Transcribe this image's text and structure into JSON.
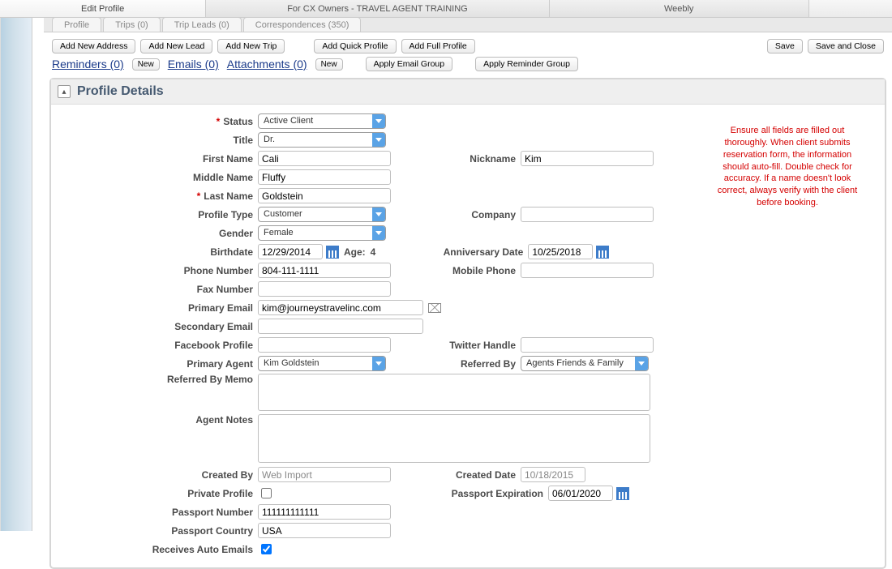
{
  "topTabs": [
    "Edit Profile",
    "For CX Owners - TRAVEL AGENT TRAINING",
    "Weebly"
  ],
  "subTabs": [
    "Profile",
    "Trips (0)",
    "Trip Leads (0)",
    "Correspondences (350)"
  ],
  "toolbar": {
    "addAddress": "Add New Address",
    "addLead": "Add New Lead",
    "addTrip": "Add New Trip",
    "addQuick": "Add Quick Profile",
    "addFull": "Add Full Profile",
    "save": "Save",
    "saveClose": "Save and Close"
  },
  "linkbar": {
    "reminders": "Reminders (0)",
    "new1": "New",
    "emails": "Emails (0)",
    "attachments": "Attachments (0)",
    "new2": "New",
    "applyEmail": "Apply Email Group",
    "applyReminder": "Apply Reminder Group"
  },
  "panelTitle": "Profile Details",
  "labels": {
    "status": "Status",
    "title": "Title",
    "firstName": "First Name",
    "middleName": "Middle Name",
    "lastName": "Last Name",
    "profileType": "Profile Type",
    "gender": "Gender",
    "birthdate": "Birthdate",
    "age": "Age:",
    "phone": "Phone Number",
    "fax": "Fax Number",
    "primaryEmail": "Primary Email",
    "secondaryEmail": "Secondary Email",
    "facebook": "Facebook Profile",
    "primaryAgent": "Primary Agent",
    "referredMemo": "Referred By Memo",
    "agentNotes": "Agent Notes",
    "createdBy": "Created By",
    "privateProfile": "Private Profile",
    "passportNumber": "Passport Number",
    "passportCountry": "Passport Country",
    "autoEmails": "Receives Auto Emails",
    "nickname": "Nickname",
    "company": "Company",
    "anniversary": "Anniversary Date",
    "mobile": "Mobile Phone",
    "twitter": "Twitter Handle",
    "referredBy": "Referred By",
    "createdDate": "Created Date",
    "passportExp": "Passport Expiration"
  },
  "values": {
    "status": "Active Client",
    "title": "Dr.",
    "firstName": "Cali",
    "middleName": "Fluffy",
    "lastName": "Goldstein",
    "profileType": "Customer",
    "gender": "Female",
    "birthdate": "12/29/2014",
    "ageVal": "4",
    "phone": "804-111-1111",
    "fax": "",
    "primaryEmail": "kim@journeystravelinc.com",
    "secondaryEmail": "",
    "facebook": "",
    "primaryAgent": "Kim Goldstein",
    "referredMemo": "",
    "agentNotes": "",
    "createdBy": "Web Import",
    "privateProfile": false,
    "passportNumber": "111111111111",
    "passportCountry": "USA",
    "autoEmails": true,
    "nickname": "Kim",
    "company": "",
    "anniversary": "10/25/2018",
    "mobile": "",
    "twitter": "",
    "referredBy": "Agents Friends & Family",
    "createdDate": "10/18/2015",
    "passportExp": "06/01/2020"
  },
  "warning": "Ensure all fields are filled out thoroughly.  When client submits reservation form, the information should auto-fill.  Double check for accuracy.  If a name doesn't look correct, always verify with the client before booking."
}
